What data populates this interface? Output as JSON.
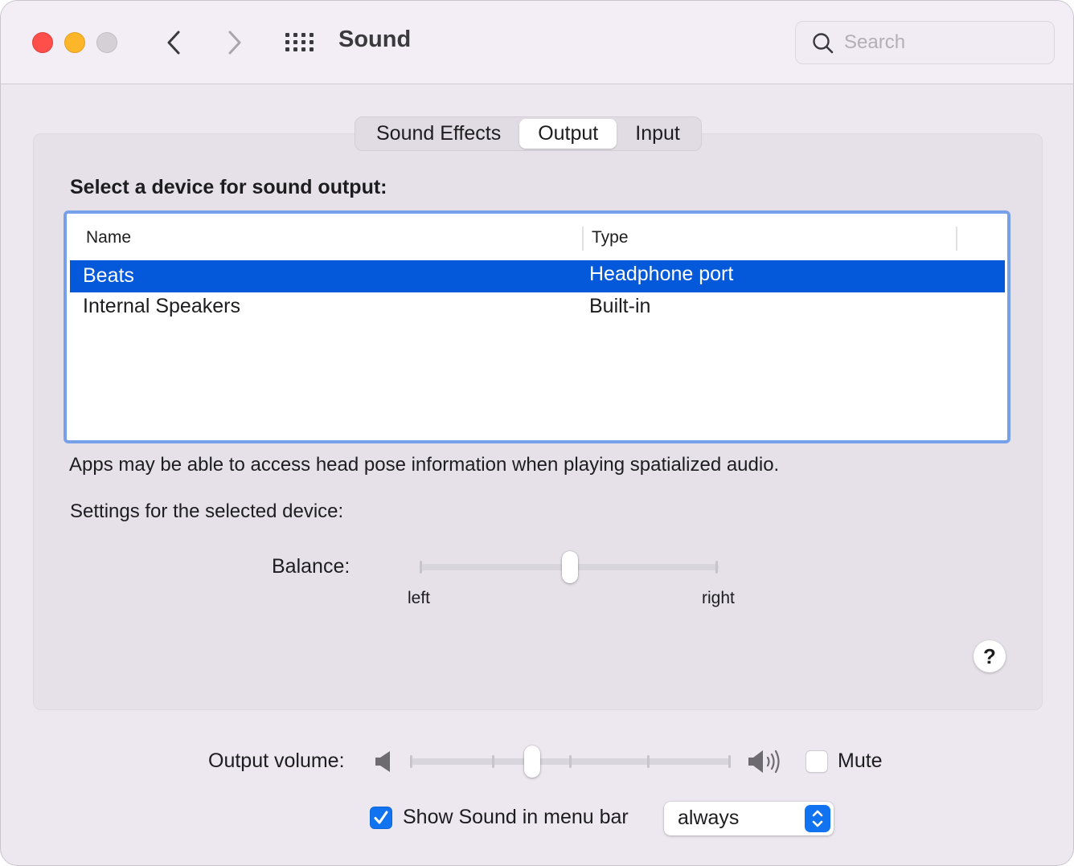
{
  "window": {
    "title": "Sound",
    "controls": [
      "close",
      "minimize",
      "zoom"
    ],
    "nav": {
      "back_icon": "chevron-left-icon",
      "forward_icon": "chevron-right-icon",
      "grid_icon": "show-all-grid-icon"
    }
  },
  "search": {
    "placeholder": "Search",
    "value": "",
    "icon": "search-icon"
  },
  "tabs": [
    {
      "label": "Sound Effects",
      "active": false
    },
    {
      "label": "Output",
      "active": true
    },
    {
      "label": "Input",
      "active": false
    }
  ],
  "output": {
    "section_title": "Select a device for sound output:",
    "columns": [
      "Name",
      "Type"
    ],
    "devices": [
      {
        "name": "Beats",
        "type": "Headphone port",
        "selected": true
      },
      {
        "name": "Internal Speakers",
        "type": "Built-in",
        "selected": false
      }
    ],
    "note": "Apps may be able to access head pose information when playing spatialized audio.",
    "settings_label": "Settings for the selected device:",
    "balance": {
      "label": "Balance:",
      "left_label": "left",
      "right_label": "right",
      "value": 0.5
    },
    "help_label": "?"
  },
  "volume": {
    "label": "Output volume:",
    "value": 0.38,
    "low_icon": "speaker-low-icon",
    "high_icon": "speaker-high-icon",
    "mute": {
      "label": "Mute",
      "checked": false
    }
  },
  "menubar": {
    "checkbox_label": "Show Sound in menu bar",
    "checked": true,
    "popup_value": "always"
  },
  "colors": {
    "accent": "#1273f0",
    "selection": "#0359da",
    "focus_ring": "#76a1ea",
    "close": "#fe4f4a",
    "minimize": "#fdb52a"
  }
}
